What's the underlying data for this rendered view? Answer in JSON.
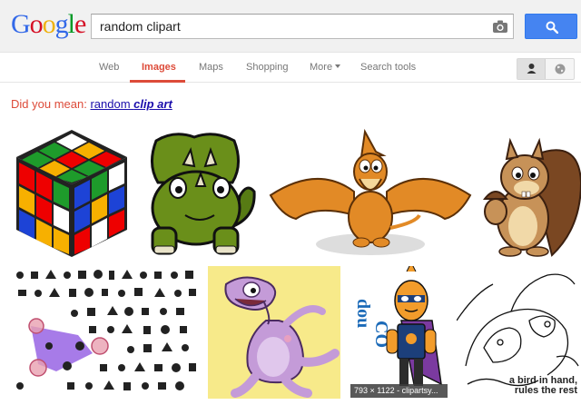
{
  "logo": {
    "letters": [
      "G",
      "o",
      "o",
      "g",
      "l",
      "e"
    ],
    "colors": [
      "#3369e8",
      "#d50f25",
      "#eeb211",
      "#3369e8",
      "#009925",
      "#d50f25"
    ]
  },
  "search": {
    "query": "random clipart"
  },
  "nav": {
    "web": "Web",
    "images": "Images",
    "maps": "Maps",
    "shopping": "Shopping",
    "more": "More",
    "search_tools": "Search tools"
  },
  "suggestion": {
    "prefix": "Did you mean:",
    "plain": "random",
    "bold": "clip art"
  },
  "results": {
    "hovered_caption": "793 × 1122 - clipartsy...",
    "bird_line1": "a bird in hand,",
    "bird_line2": "rules the rest"
  },
  "colors": {
    "accent_red": "#dd4b39",
    "search_blue": "#4584f1",
    "link_blue": "#1a0dab"
  }
}
